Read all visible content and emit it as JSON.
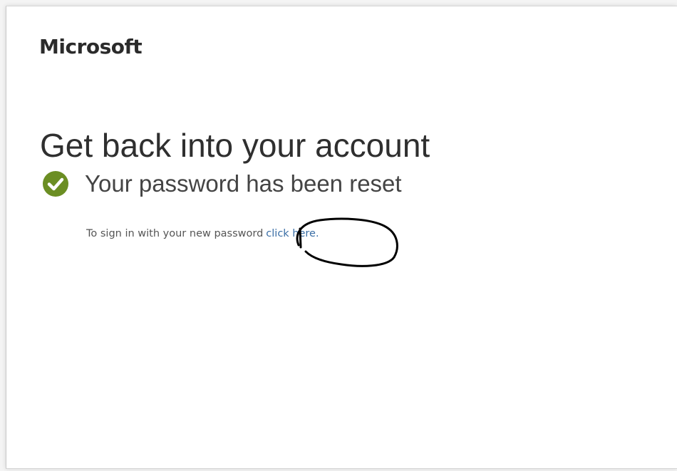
{
  "brand": {
    "name": "Microsoft"
  },
  "main": {
    "title": "Get back into your account",
    "status": {
      "icon": "checkmark-circle-icon",
      "icon_color": "#6b8e23",
      "text": "Your password has been reset"
    },
    "instruction": {
      "text": "To sign in with your new password",
      "link_text": "click here."
    }
  },
  "colors": {
    "link": "#3a6ea5",
    "annotation": "#000000"
  }
}
